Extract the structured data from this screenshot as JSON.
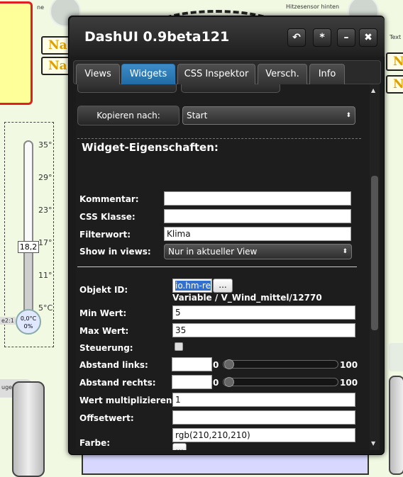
{
  "background": {
    "icon_left_label": "ne",
    "icon_right_label": "Hitzesensor hinten",
    "text_right_label": "Text",
    "na_labels": [
      "Na",
      "Na",
      "Na",
      "Na"
    ],
    "thermometer": {
      "ticks": [
        "35°",
        "29°",
        "23°",
        "17°",
        "11°",
        "5°C"
      ],
      "value": "18,2",
      "bulb_line1": "0,0°C",
      "bulb_line2": "0%",
      "side_label": "e2:1"
    },
    "pill_label": "uge"
  },
  "dialog": {
    "title": "DashUI 0.9beta121",
    "buttons": {
      "undo": "↶",
      "star": "*",
      "minimize": "–",
      "close": "✖"
    },
    "tabs": [
      {
        "label": "Views"
      },
      {
        "label": "Widgets",
        "active": true
      },
      {
        "label": "CSS Inspektor"
      },
      {
        "label": "Versch."
      },
      {
        "label": "Info"
      }
    ],
    "copy_to": {
      "label": "Kopieren nach:",
      "selected": "Start"
    },
    "section_title": "Widget-Eigenschaften:",
    "fields": {
      "kommentar": {
        "label": "Kommentar:",
        "value": ""
      },
      "css_klasse": {
        "label": "CSS Klasse:",
        "value": ""
      },
      "filterwort": {
        "label": "Filterwort:",
        "value": "Klima"
      },
      "show_in_views": {
        "label": "Show in views:",
        "selected": "Nur in aktueller View"
      },
      "objekt_id": {
        "label": "Objekt ID:",
        "value": "io.hm-re",
        "browse": "...",
        "hint": "Variable / V_Wind_mittel/12770"
      },
      "min_wert": {
        "label": "Min Wert:",
        "value": "5"
      },
      "max_wert": {
        "label": "Max Wert:",
        "value": "35"
      },
      "steuerung": {
        "label": "Steuerung:",
        "checked": false
      },
      "abstand_links": {
        "label": "Abstand links:",
        "value": "",
        "min": "0",
        "max": "100"
      },
      "abstand_rechts": {
        "label": "Abstand rechts:",
        "value": "",
        "min": "0",
        "max": "100"
      },
      "wert_multiplizieren": {
        "label": "Wert multiplizieren:",
        "value": "1"
      },
      "offsetwert": {
        "label": "Offsetwert:",
        "value": ""
      },
      "farbe": {
        "label": "Farbe:",
        "value": "rgb(210,210,210)",
        "browse": "..."
      }
    }
  }
}
